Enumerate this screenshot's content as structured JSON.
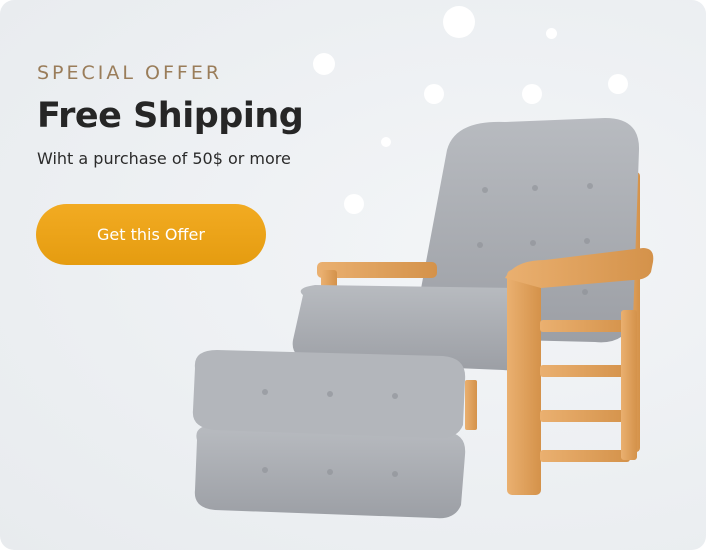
{
  "promo": {
    "eyebrow": "SPECIAL OFFER",
    "title": "Free Shipping",
    "subtitle": "Wiht a purchase of 50$ or more",
    "cta_label": "Get this Offer"
  },
  "colors": {
    "accent": "#eea51b",
    "eyebrow": "#9a7d5a",
    "title": "#262626",
    "cushion": "#a9acb1",
    "wood": "#e2a55e"
  },
  "illustration": {
    "subject": "armchair-with-ottoman"
  }
}
